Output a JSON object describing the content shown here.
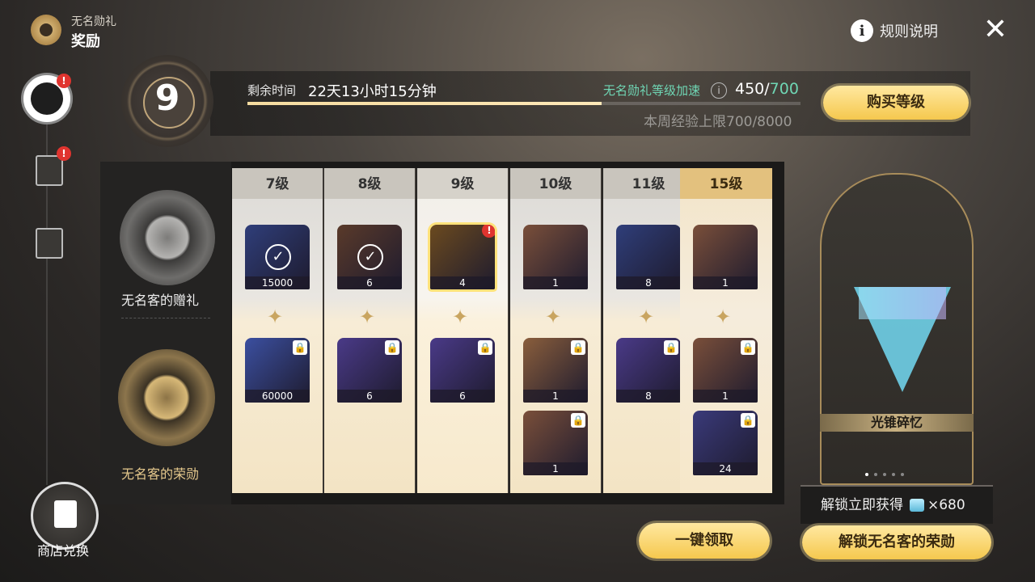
{
  "header": {
    "subtitle": "无名勋礼",
    "title": "奖励"
  },
  "rules_label": "规则说明",
  "rail": {
    "shop_label": "商店兑换",
    "badge": "!"
  },
  "level": {
    "current": "9",
    "time_label": "剩余时间",
    "time_value": "22天13小时15分钟",
    "time_progress_fraction": 0.64,
    "boost_label": "无名勋礼等级加速",
    "xp_current": "450",
    "xp_max": "700",
    "weekly_cap": "本周经验上限700/8000",
    "buy_label": "购买等级"
  },
  "tracks": {
    "free_name": "无名客的赠礼",
    "paid_name": "无名客的荣勋"
  },
  "columns": [
    {
      "level": "7级",
      "free": {
        "count": "15000",
        "claimed": true,
        "color": "#2f3e7a"
      },
      "paid": [
        {
          "count": "60000",
          "locked": true,
          "color": "#3b4fa0"
        }
      ]
    },
    {
      "level": "8级",
      "free": {
        "count": "6",
        "claimed": true,
        "color": "#5a3a2a"
      },
      "paid": [
        {
          "count": "6",
          "locked": true,
          "color": "#4a3a88"
        }
      ]
    },
    {
      "level": "9级",
      "free": {
        "count": "4",
        "claimed": false,
        "alert": true,
        "color": "#6b4a1f"
      },
      "paid": [
        {
          "count": "6",
          "locked": true,
          "color": "#4a3a88"
        }
      ]
    },
    {
      "level": "10级",
      "free": {
        "count": "1",
        "claimed": false,
        "color": "#7a4f3a"
      },
      "paid": [
        {
          "count": "1",
          "locked": true,
          "color": "#8a5e3c"
        },
        {
          "count": "1",
          "locked": true,
          "color": "#7a4f3a"
        }
      ]
    },
    {
      "level": "11级",
      "free": {
        "count": "8",
        "claimed": false,
        "color": "#2f3e7a"
      },
      "paid": [
        {
          "count": "8",
          "locked": true,
          "color": "#4a3a88"
        }
      ]
    },
    {
      "level": "15级",
      "free": {
        "count": "1",
        "claimed": false,
        "color": "#7a4f3a"
      },
      "paid": [
        {
          "count": "1",
          "locked": true,
          "color": "#7a4f3a"
        },
        {
          "count": "24",
          "locked": true,
          "color": "#3a3a7a"
        }
      ]
    }
  ],
  "preview": {
    "label": "光锥碎忆",
    "page_count": 5,
    "page_current": 1
  },
  "unlock_tip": {
    "text": "解锁立即获得",
    "amount": "×680"
  },
  "buttons": {
    "claim_all": "一键领取",
    "unlock": "解锁无名客的荣勋"
  }
}
